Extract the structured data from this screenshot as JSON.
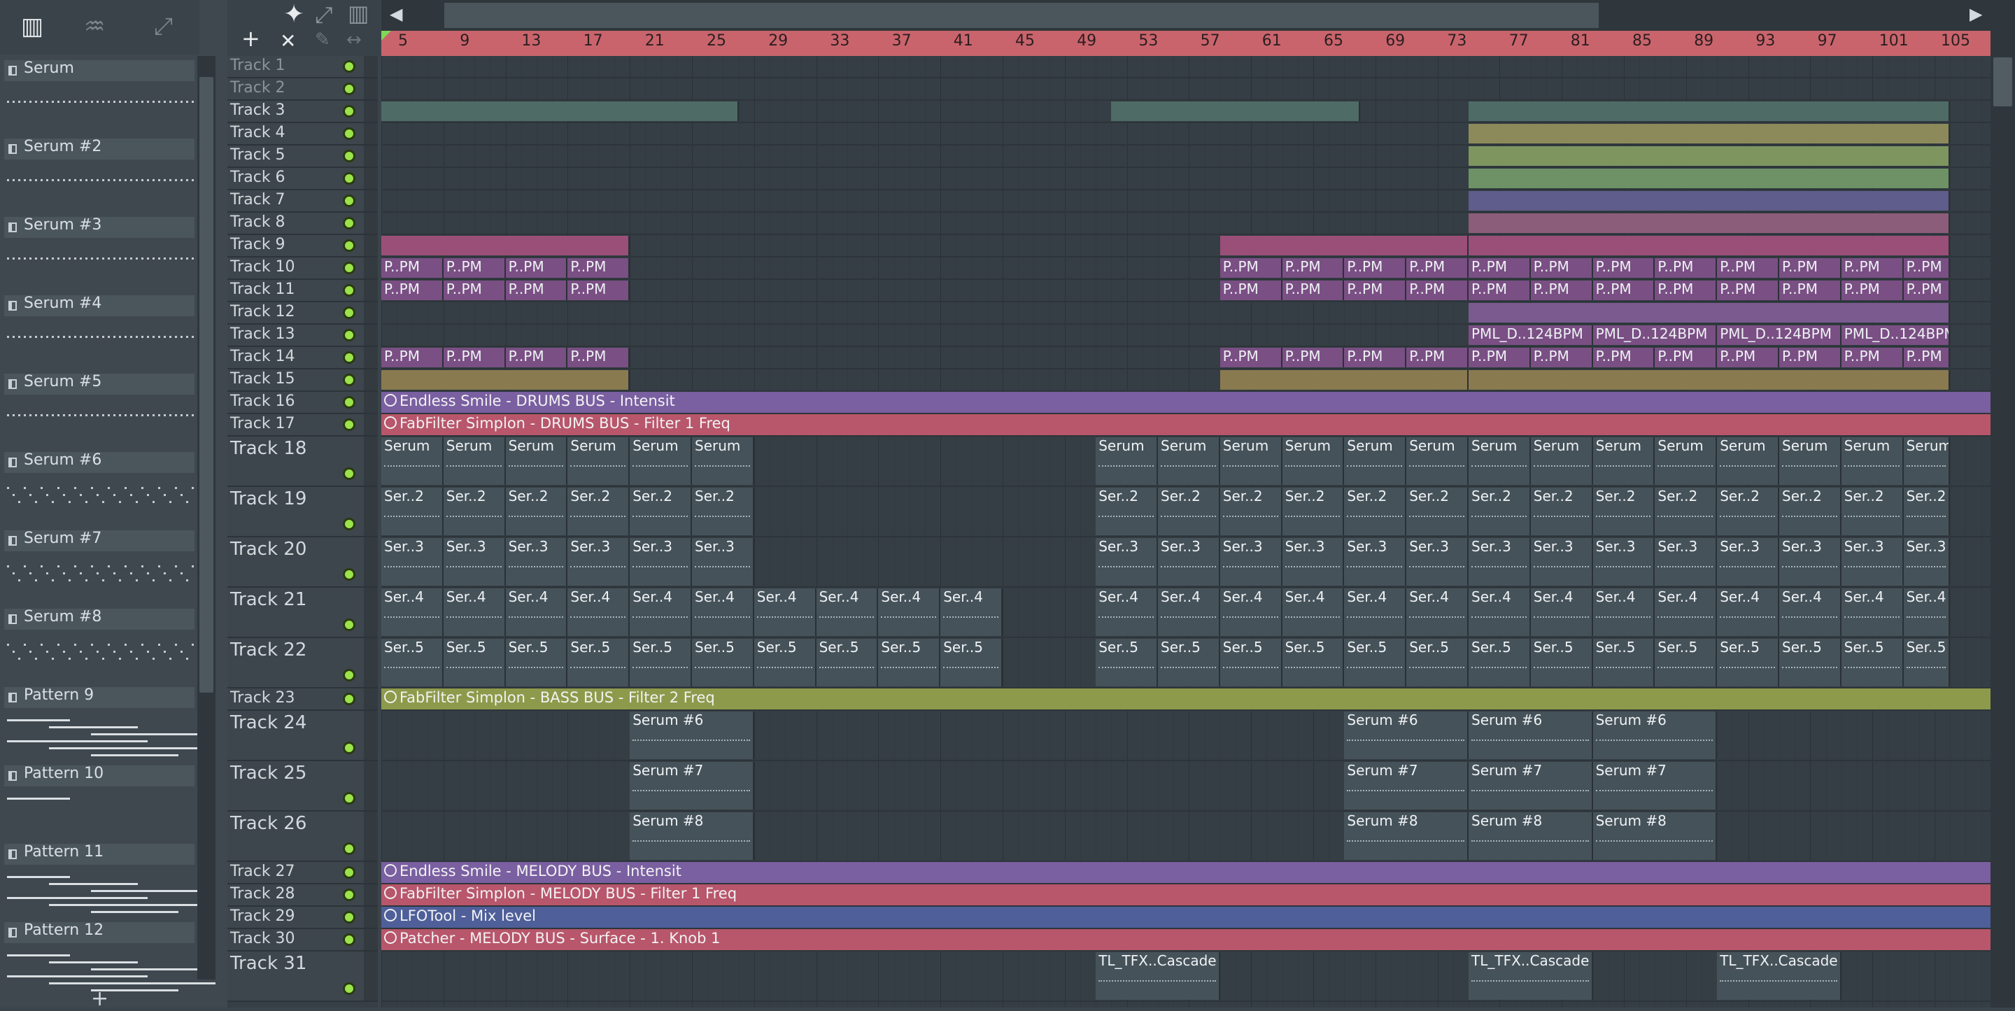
{
  "picker": {
    "patterns": [
      {
        "name": "Serum",
        "type": "notes"
      },
      {
        "name": "Serum #2",
        "type": "notes"
      },
      {
        "name": "Serum #3",
        "type": "notes"
      },
      {
        "name": "Serum #4",
        "type": "notes"
      },
      {
        "name": "Serum #5",
        "type": "notes"
      },
      {
        "name": "Serum #6",
        "type": "notes"
      },
      {
        "name": "Serum #7",
        "type": "notes"
      },
      {
        "name": "Serum #8",
        "type": "notes"
      },
      {
        "name": "Pattern 9",
        "type": "lines"
      },
      {
        "name": "Pattern 10",
        "type": "lines"
      },
      {
        "name": "Pattern 11",
        "type": "lines"
      },
      {
        "name": "Pattern 12",
        "type": "lines"
      }
    ],
    "add_icon": "+"
  },
  "toolbar": {
    "plus_icon": "+",
    "close_icon": "✕"
  },
  "ruler": {
    "ticks": [
      "5",
      "9",
      "13",
      "17",
      "21",
      "25",
      "29",
      "33",
      "37",
      "41",
      "45",
      "49",
      "53",
      "57",
      "61",
      "65",
      "69",
      "73",
      "77",
      "81",
      "85",
      "89",
      "93",
      "97",
      "101",
      "105"
    ]
  },
  "tracks": [
    {
      "name": "Track 1",
      "tall": false
    },
    {
      "name": "Track 2",
      "tall": false
    },
    {
      "name": "Track 3",
      "tall": false
    },
    {
      "name": "Track 4",
      "tall": false
    },
    {
      "name": "Track 5",
      "tall": false
    },
    {
      "name": "Track 6",
      "tall": false
    },
    {
      "name": "Track 7",
      "tall": false
    },
    {
      "name": "Track 8",
      "tall": false
    },
    {
      "name": "Track 9",
      "tall": false
    },
    {
      "name": "Track 10",
      "tall": false
    },
    {
      "name": "Track 11",
      "tall": false
    },
    {
      "name": "Track 12",
      "tall": false
    },
    {
      "name": "Track 13",
      "tall": false
    },
    {
      "name": "Track 14",
      "tall": false
    },
    {
      "name": "Track 15",
      "tall": false
    },
    {
      "name": "Track 16",
      "tall": false
    },
    {
      "name": "Track 17",
      "tall": false
    },
    {
      "name": "Track 18",
      "tall": true
    },
    {
      "name": "Track 19",
      "tall": true
    },
    {
      "name": "Track 20",
      "tall": true
    },
    {
      "name": "Track 21",
      "tall": true
    },
    {
      "name": "Track 22",
      "tall": true
    },
    {
      "name": "Track 23",
      "tall": false
    },
    {
      "name": "Track 24",
      "tall": true
    },
    {
      "name": "Track 25",
      "tall": true
    },
    {
      "name": "Track 26",
      "tall": true
    },
    {
      "name": "Track 27",
      "tall": false
    },
    {
      "name": "Track 28",
      "tall": false
    },
    {
      "name": "Track 29",
      "tall": false
    },
    {
      "name": "Track 30",
      "tall": false
    },
    {
      "name": "Track 31",
      "tall": true
    }
  ],
  "automation": [
    {
      "track": 16,
      "label": "Endless Smile - DRUMS BUS - Intensit",
      "color": "#7a5fa1"
    },
    {
      "track": 17,
      "label": "FabFilter Simplon - DRUMS BUS - Filter 1 Freq",
      "color": "#b8566b"
    },
    {
      "track": 23,
      "label": "FabFilter Simplon - BASS BUS - Filter 2 Freq",
      "color": "#8d9a4b"
    },
    {
      "track": 27,
      "label": "Endless Smile - MELODY BUS - Intensit",
      "color": "#7a5fa1"
    },
    {
      "track": 28,
      "label": "FabFilter Simplon - MELODY BUS - Filter 1 Freq",
      "color": "#b8566b"
    },
    {
      "track": 29,
      "label": "LFOTool - Mix level",
      "color": "#4e5f9a"
    },
    {
      "track": 30,
      "label": "Patcher - MELODY BUS - Surface - 1. Knob 1",
      "color": "#b8566b"
    }
  ],
  "clips": [
    {
      "track": 3,
      "segments": [
        [
          1,
          24
        ],
        [
          48,
          64
        ],
        [
          71,
          102
        ]
      ],
      "label": "",
      "color": "#4f6b66"
    },
    {
      "track": 4,
      "segments": [
        [
          71,
          102
        ]
      ],
      "label": "",
      "color": "#8c8a5a"
    },
    {
      "track": 5,
      "segments": [
        [
          71,
          102
        ]
      ],
      "label": "",
      "color": "#7e9560"
    },
    {
      "track": 6,
      "segments": [
        [
          71,
          102
        ]
      ],
      "label": "",
      "color": "#6e9266"
    },
    {
      "track": 7,
      "segments": [
        [
          71,
          102
        ]
      ],
      "label": "",
      "color": "#5f5d8c"
    },
    {
      "track": 8,
      "segments": [
        [
          71,
          102
        ]
      ],
      "label": "",
      "color": "#8c5d7a"
    },
    {
      "track": 9,
      "segments": [
        [
          1,
          17
        ],
        [
          55,
          71
        ],
        [
          71,
          102
        ]
      ],
      "label": "",
      "color": "#9a4f78"
    },
    {
      "track": 10,
      "segments": [
        [
          1,
          5
        ],
        [
          5,
          9
        ],
        [
          9,
          13
        ],
        [
          13,
          17
        ],
        [
          55,
          59
        ],
        [
          59,
          63
        ],
        [
          63,
          67
        ],
        [
          67,
          71
        ],
        [
          71,
          75
        ],
        [
          75,
          79
        ],
        [
          79,
          83
        ],
        [
          83,
          87
        ],
        [
          87,
          91
        ],
        [
          91,
          95
        ],
        [
          95,
          99
        ],
        [
          99,
          102
        ]
      ],
      "label": "P..PM",
      "color": "#7a4f84"
    },
    {
      "track": 11,
      "segments": [
        [
          1,
          5
        ],
        [
          5,
          9
        ],
        [
          9,
          13
        ],
        [
          13,
          17
        ],
        [
          55,
          59
        ],
        [
          59,
          63
        ],
        [
          63,
          67
        ],
        [
          67,
          71
        ],
        [
          71,
          75
        ],
        [
          75,
          79
        ],
        [
          79,
          83
        ],
        [
          83,
          87
        ],
        [
          87,
          91
        ],
        [
          91,
          95
        ],
        [
          95,
          99
        ],
        [
          99,
          102
        ]
      ],
      "label": "P..PM",
      "color": "#7a4f84"
    },
    {
      "track": 12,
      "segments": [
        [
          71,
          102
        ]
      ],
      "label": "",
      "color": "#7a5a8f"
    },
    {
      "track": 13,
      "segments": [
        [
          71,
          79
        ],
        [
          79,
          87
        ],
        [
          87,
          95
        ],
        [
          95,
          102
        ]
      ],
      "label": "PML_D..124BPM",
      "color": "#7a4f84"
    },
    {
      "track": 14,
      "segments": [
        [
          1,
          5
        ],
        [
          5,
          9
        ],
        [
          9,
          13
        ],
        [
          13,
          17
        ],
        [
          55,
          59
        ],
        [
          59,
          63
        ],
        [
          63,
          67
        ],
        [
          67,
          71
        ],
        [
          71,
          75
        ],
        [
          75,
          79
        ],
        [
          79,
          83
        ],
        [
          83,
          87
        ],
        [
          87,
          91
        ],
        [
          91,
          95
        ],
        [
          95,
          99
        ],
        [
          99,
          102
        ]
      ],
      "label": "P..PM",
      "color": "#7a4f84"
    },
    {
      "track": 15,
      "segments": [
        [
          1,
          17
        ],
        [
          55,
          71
        ],
        [
          71,
          102
        ]
      ],
      "label": "",
      "color": "#8a7a50"
    },
    {
      "track": 18,
      "segments": [
        [
          1,
          5
        ],
        [
          5,
          9
        ],
        [
          9,
          13
        ],
        [
          13,
          17
        ],
        [
          17,
          21
        ],
        [
          21,
          25
        ],
        [
          47,
          51
        ],
        [
          51,
          55
        ],
        [
          55,
          59
        ],
        [
          59,
          63
        ],
        [
          63,
          67
        ],
        [
          67,
          71
        ],
        [
          71,
          75
        ],
        [
          75,
          79
        ],
        [
          79,
          83
        ],
        [
          83,
          87
        ],
        [
          87,
          91
        ],
        [
          91,
          95
        ],
        [
          95,
          99
        ],
        [
          99,
          102
        ]
      ],
      "label": "Serum",
      "color": "#46525a"
    },
    {
      "track": 19,
      "segments": [
        [
          1,
          5
        ],
        [
          5,
          9
        ],
        [
          9,
          13
        ],
        [
          13,
          17
        ],
        [
          17,
          21
        ],
        [
          21,
          25
        ],
        [
          47,
          51
        ],
        [
          51,
          55
        ],
        [
          55,
          59
        ],
        [
          59,
          63
        ],
        [
          63,
          67
        ],
        [
          67,
          71
        ],
        [
          71,
          75
        ],
        [
          75,
          79
        ],
        [
          79,
          83
        ],
        [
          83,
          87
        ],
        [
          87,
          91
        ],
        [
          91,
          95
        ],
        [
          95,
          99
        ],
        [
          99,
          102
        ]
      ],
      "label": "Ser..2",
      "color": "#46525a"
    },
    {
      "track": 20,
      "segments": [
        [
          1,
          5
        ],
        [
          5,
          9
        ],
        [
          9,
          13
        ],
        [
          13,
          17
        ],
        [
          17,
          21
        ],
        [
          21,
          25
        ],
        [
          47,
          51
        ],
        [
          51,
          55
        ],
        [
          55,
          59
        ],
        [
          59,
          63
        ],
        [
          63,
          67
        ],
        [
          67,
          71
        ],
        [
          71,
          75
        ],
        [
          75,
          79
        ],
        [
          79,
          83
        ],
        [
          83,
          87
        ],
        [
          87,
          91
        ],
        [
          91,
          95
        ],
        [
          95,
          99
        ],
        [
          99,
          102
        ]
      ],
      "label": "Ser..3",
      "color": "#46525a"
    },
    {
      "track": 21,
      "segments": [
        [
          1,
          5
        ],
        [
          5,
          9
        ],
        [
          9,
          13
        ],
        [
          13,
          17
        ],
        [
          17,
          21
        ],
        [
          21,
          25
        ],
        [
          25,
          29
        ],
        [
          29,
          33
        ],
        [
          33,
          37
        ],
        [
          37,
          41
        ],
        [
          47,
          51
        ],
        [
          51,
          55
        ],
        [
          55,
          59
        ],
        [
          59,
          63
        ],
        [
          63,
          67
        ],
        [
          67,
          71
        ],
        [
          71,
          75
        ],
        [
          75,
          79
        ],
        [
          79,
          83
        ],
        [
          83,
          87
        ],
        [
          87,
          91
        ],
        [
          91,
          95
        ],
        [
          95,
          99
        ],
        [
          99,
          102
        ]
      ],
      "label": "Ser..4",
      "color": "#46525a"
    },
    {
      "track": 22,
      "segments": [
        [
          1,
          5
        ],
        [
          5,
          9
        ],
        [
          9,
          13
        ],
        [
          13,
          17
        ],
        [
          17,
          21
        ],
        [
          21,
          25
        ],
        [
          25,
          29
        ],
        [
          29,
          33
        ],
        [
          33,
          37
        ],
        [
          37,
          41
        ],
        [
          47,
          51
        ],
        [
          51,
          55
        ],
        [
          55,
          59
        ],
        [
          59,
          63
        ],
        [
          63,
          67
        ],
        [
          67,
          71
        ],
        [
          71,
          75
        ],
        [
          75,
          79
        ],
        [
          79,
          83
        ],
        [
          83,
          87
        ],
        [
          87,
          91
        ],
        [
          91,
          95
        ],
        [
          95,
          99
        ],
        [
          99,
          102
        ]
      ],
      "label": "Ser..5",
      "color": "#46525a"
    },
    {
      "track": 24,
      "segments": [
        [
          17,
          25
        ],
        [
          63,
          71
        ],
        [
          71,
          79
        ],
        [
          79,
          87
        ]
      ],
      "label": "Serum #6",
      "color": "#46525a"
    },
    {
      "track": 25,
      "segments": [
        [
          17,
          25
        ],
        [
          63,
          71
        ],
        [
          71,
          79
        ],
        [
          79,
          87
        ]
      ],
      "label": "Serum #7",
      "color": "#46525a"
    },
    {
      "track": 26,
      "segments": [
        [
          17,
          25
        ],
        [
          63,
          71
        ],
        [
          71,
          79
        ],
        [
          79,
          87
        ]
      ],
      "label": "Serum #8",
      "color": "#46525a"
    },
    {
      "track": 31,
      "segments": [
        [
          47,
          55
        ],
        [
          71,
          79
        ],
        [
          87,
          95
        ]
      ],
      "label": "TL_TFX..Cascade",
      "color": "#46525a"
    }
  ],
  "colors": {
    "ruler": "#c9646c",
    "led": "#9be34b",
    "grid": "#353e44"
  }
}
